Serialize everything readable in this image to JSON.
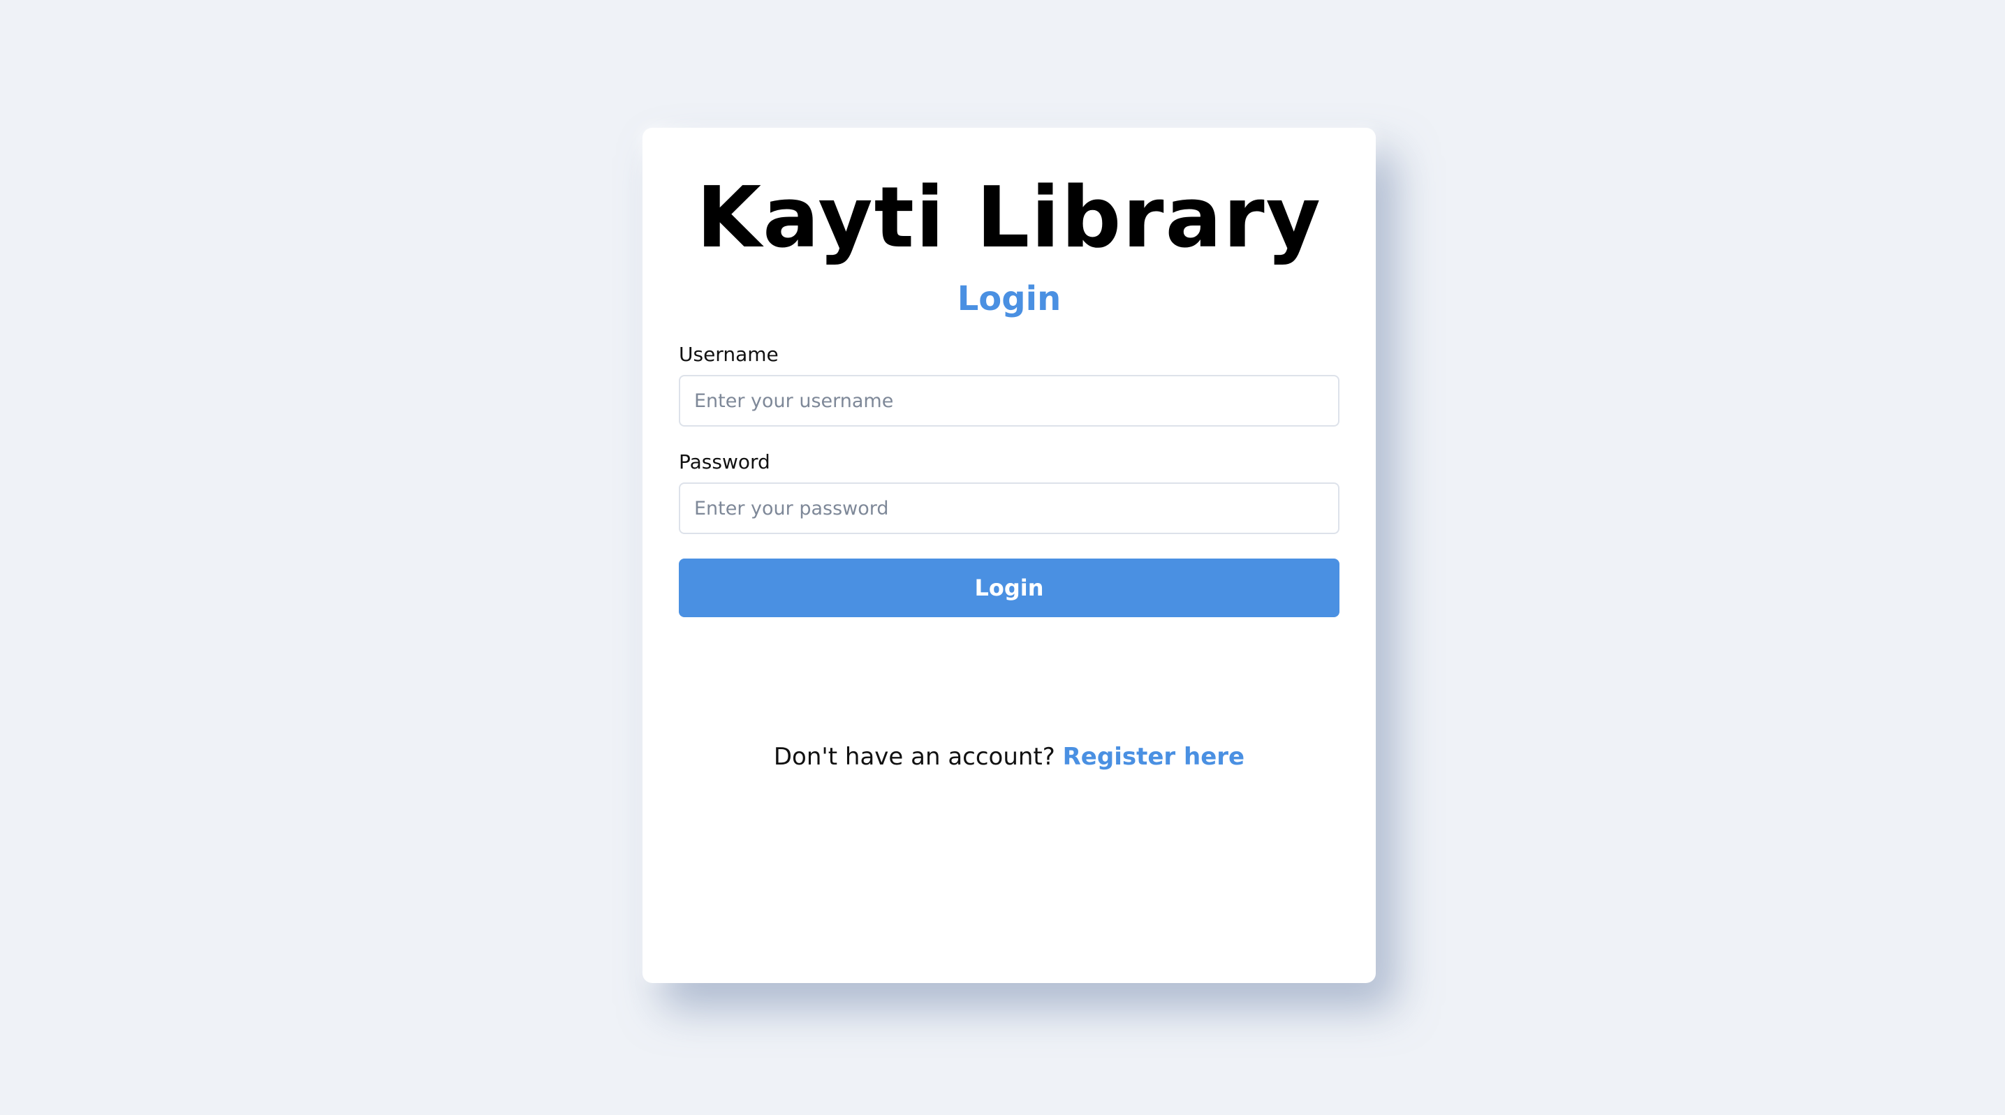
{
  "app": {
    "title": "Kayti Library",
    "subtitle": "Login"
  },
  "form": {
    "username_label": "Username",
    "username_placeholder": "Enter your username",
    "username_value": "",
    "password_label": "Password",
    "password_placeholder": "Enter your password",
    "password_value": "",
    "submit_label": "Login"
  },
  "footer": {
    "prompt_text": "Don't have an account?",
    "register_link_text": "Register here"
  },
  "colors": {
    "background": "#eff2f7",
    "card": "#ffffff",
    "accent": "#4a90e2",
    "text": "#111111"
  }
}
